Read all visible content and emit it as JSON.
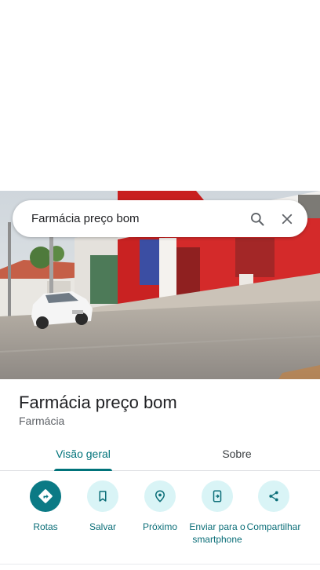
{
  "search": {
    "query": "Farmácia preço bom"
  },
  "place": {
    "name": "Farmácia preço bom",
    "category": "Farmácia"
  },
  "tabs": [
    {
      "label": "Visão geral",
      "selected": true
    },
    {
      "label": "Sobre",
      "selected": false
    }
  ],
  "actions": [
    {
      "label": "Rotas",
      "icon": "directions-icon"
    },
    {
      "label": "Salvar",
      "icon": "bookmark-icon"
    },
    {
      "label": "Próximo",
      "icon": "nearby-icon"
    },
    {
      "label": "Enviar para o smartphone",
      "icon": "send-to-phone-icon"
    },
    {
      "label": "Compartilhar",
      "icon": "share-icon"
    }
  ],
  "colors": {
    "accent": "#00737a",
    "chip_bg": "#d9f4f6",
    "primary_chip": "#0b7a85"
  }
}
